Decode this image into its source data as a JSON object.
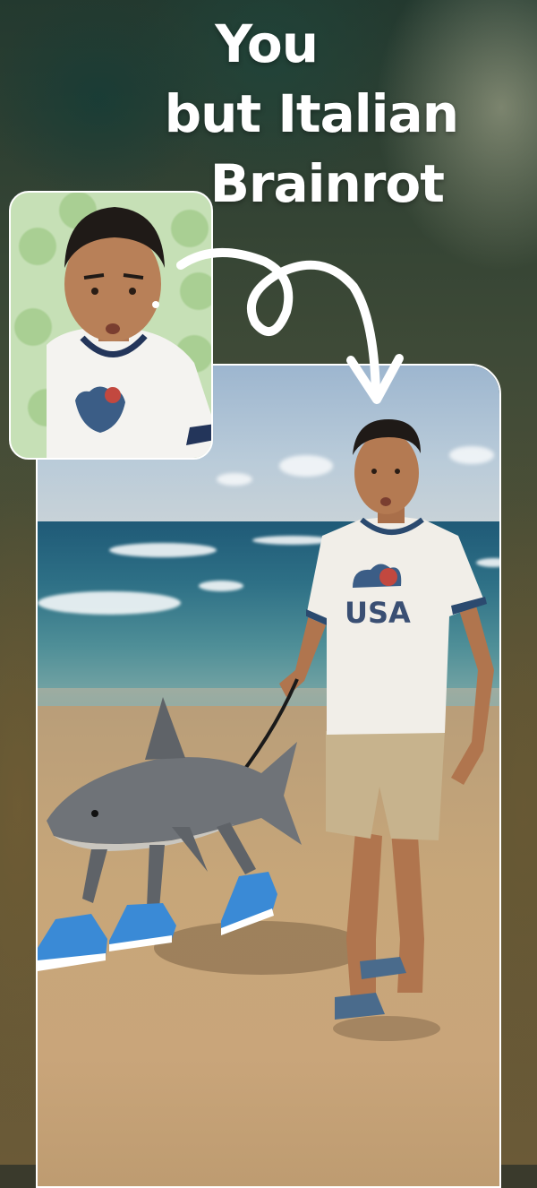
{
  "headline": {
    "line1": "You",
    "line2": "but Italian",
    "line3": "Brainrot"
  },
  "result": {
    "shirt_text": "USA"
  },
  "colors": {
    "headline_text": "#ffffff",
    "frame_border": "#ffffff",
    "sneakers": "#3a8ad6"
  },
  "icons": {
    "transform_arrow": "curly-arrow-icon"
  }
}
